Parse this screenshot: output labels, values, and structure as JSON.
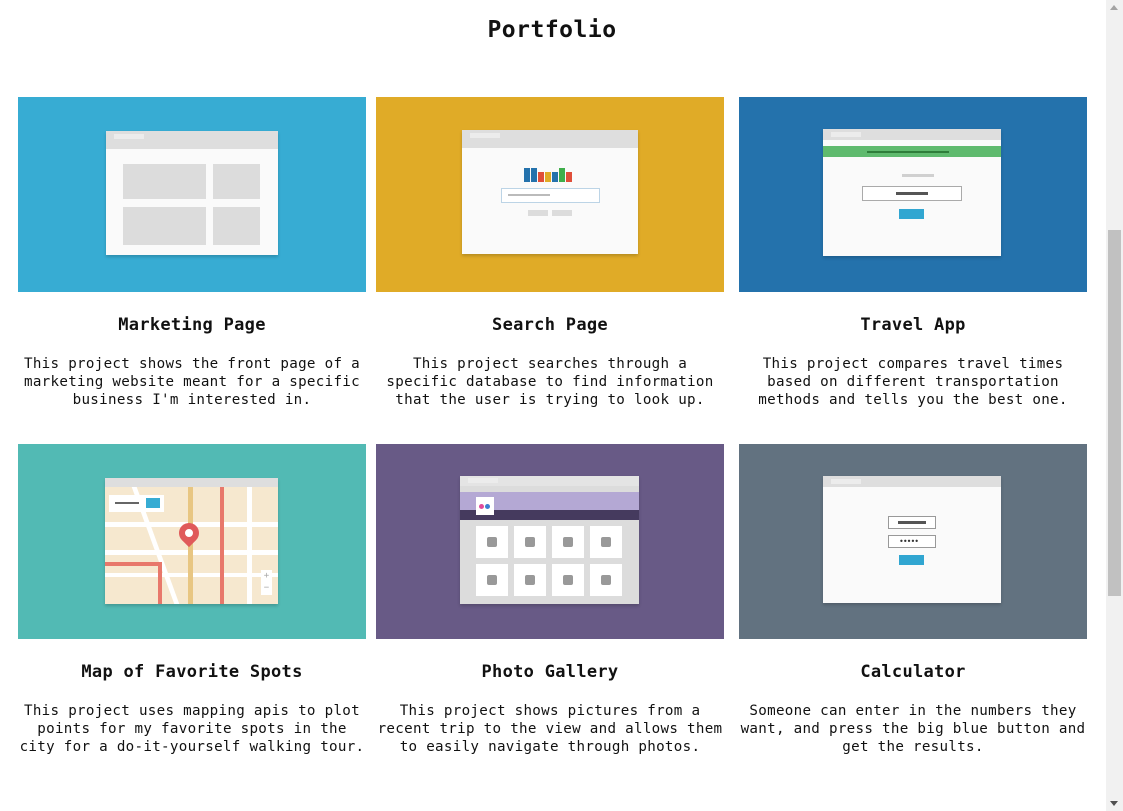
{
  "page": {
    "title": "Portfolio"
  },
  "projects": [
    {
      "title": "Marketing Page",
      "description": "This project shows the front page of a marketing website meant for a specific business I'm interested in.",
      "color": "#37acd3",
      "icon": "wireframe-icon"
    },
    {
      "title": "Search Page",
      "description": "This project searches through a specific database to find information that the user is trying to look up.",
      "color": "#e0ab27",
      "icon": "search-ui-icon"
    },
    {
      "title": "Travel App",
      "description": "This project compares travel times based on different transportation methods and tells you the best one.",
      "color": "#2472ac",
      "icon": "form-ui-icon"
    },
    {
      "title": "Map of Favorite Spots",
      "description": "This project uses mapping apis to plot points for my favorite spots in the city for a do-it-yourself walking tour.",
      "color": "#52bab4",
      "icon": "map-icon"
    },
    {
      "title": "Photo Gallery",
      "description": "This project shows pictures from a recent trip to the view and allows them to easily navigate through photos.",
      "color": "#685a86",
      "icon": "gallery-icon"
    },
    {
      "title": "Calculator",
      "description": "Someone can enter in the numbers they want, and press the big blue button and get the results.",
      "color": "#627280",
      "icon": "calculator-ui-icon"
    }
  ]
}
